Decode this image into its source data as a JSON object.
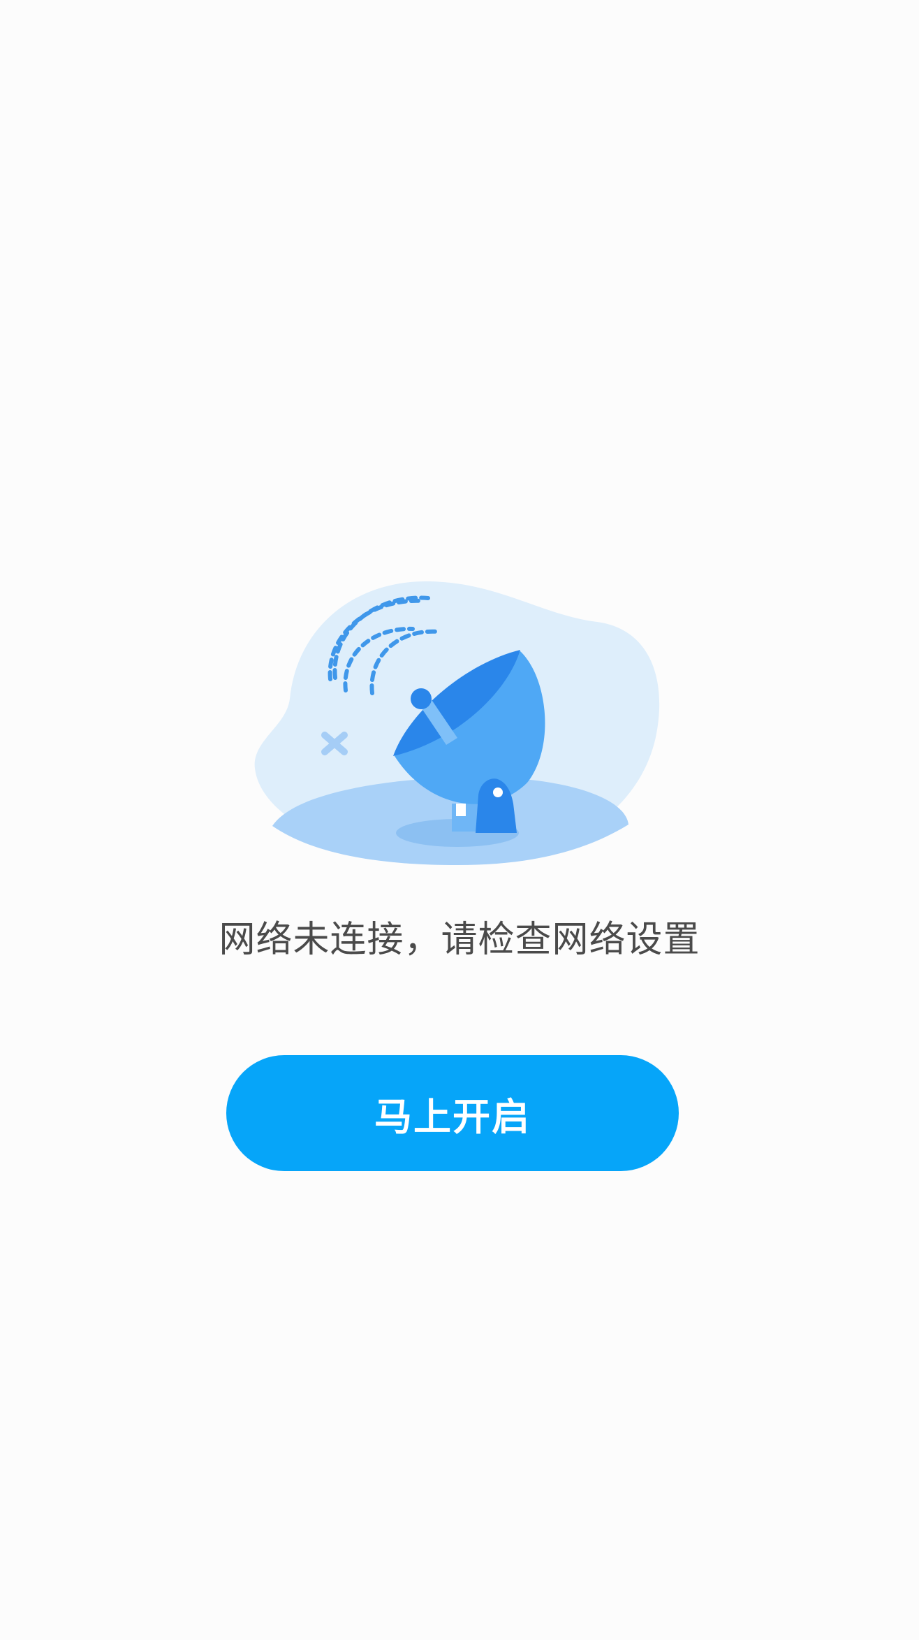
{
  "no_network": {
    "message": "网络未连接，请检查网络设置",
    "button_label": "马上开启",
    "illustration_icon": "satellite-dish-icon",
    "error_mark_icon": "close-icon",
    "signal_icon": "signal-waves-icon"
  },
  "colors": {
    "background": "#fcfcfc",
    "accent": "#06a5f9",
    "text": "#4a4a4a",
    "blob": "#deeefb",
    "ground": "#a9d1f8",
    "dish": "#4fa8f5",
    "dish_dark": "#2a86ea"
  }
}
